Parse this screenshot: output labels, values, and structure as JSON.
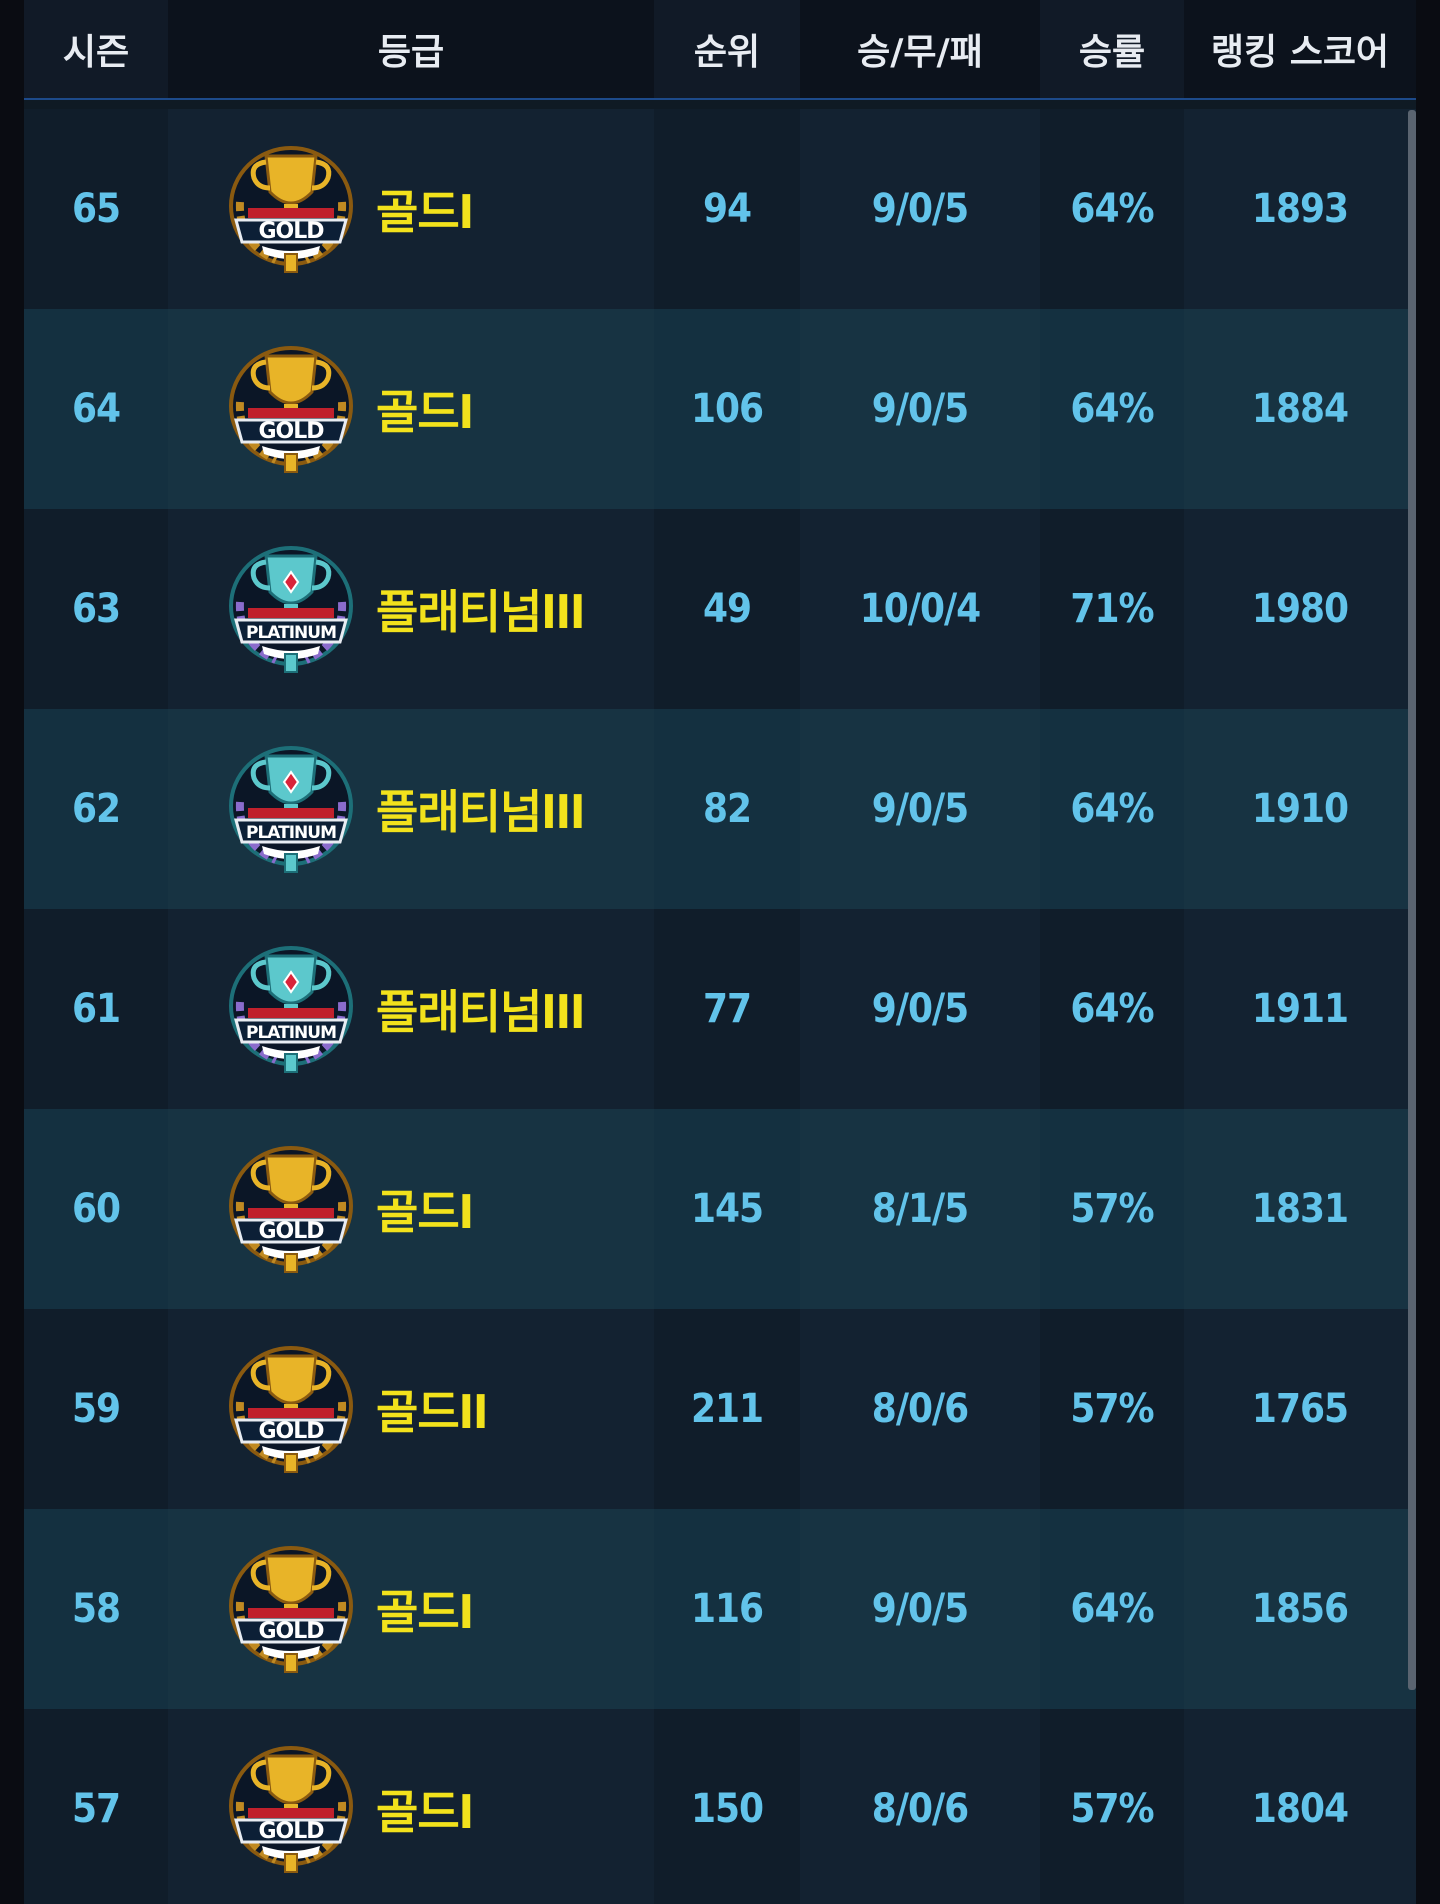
{
  "table": {
    "headers": {
      "season": "시즌",
      "grade": "등급",
      "rank": "순위",
      "wdl": "승/무/패",
      "win_rate": "승률",
      "ranking_score": "랭킹 스코어"
    },
    "rows": [
      {
        "season": "65",
        "badge": "gold-trophy-badge-icon",
        "badge_text": "GOLD",
        "tier": "골드I",
        "rank": "94",
        "wdl": "9/0/5",
        "win_rate": "64%",
        "score": "1893"
      },
      {
        "season": "64",
        "badge": "gold-trophy-badge-icon",
        "badge_text": "GOLD",
        "tier": "골드I",
        "rank": "106",
        "wdl": "9/0/5",
        "win_rate": "64%",
        "score": "1884"
      },
      {
        "season": "63",
        "badge": "platinum-trophy-badge-icon",
        "badge_text": "PLATINUM",
        "tier": "플래티넘III",
        "rank": "49",
        "wdl": "10/0/4",
        "win_rate": "71%",
        "score": "1980"
      },
      {
        "season": "62",
        "badge": "platinum-trophy-badge-icon",
        "badge_text": "PLATINUM",
        "tier": "플래티넘III",
        "rank": "82",
        "wdl": "9/0/5",
        "win_rate": "64%",
        "score": "1910"
      },
      {
        "season": "61",
        "badge": "platinum-trophy-badge-icon",
        "badge_text": "PLATINUM",
        "tier": "플래티넘III",
        "rank": "77",
        "wdl": "9/0/5",
        "win_rate": "64%",
        "score": "1911"
      },
      {
        "season": "60",
        "badge": "gold-trophy-badge-icon",
        "badge_text": "GOLD",
        "tier": "골드I",
        "rank": "145",
        "wdl": "8/1/5",
        "win_rate": "57%",
        "score": "1831"
      },
      {
        "season": "59",
        "badge": "gold-trophy-badge-icon",
        "badge_text": "GOLD",
        "tier": "골드II",
        "rank": "211",
        "wdl": "8/0/6",
        "win_rate": "57%",
        "score": "1765"
      },
      {
        "season": "58",
        "badge": "gold-trophy-badge-icon",
        "badge_text": "GOLD",
        "tier": "골드I",
        "rank": "116",
        "wdl": "9/0/5",
        "win_rate": "64%",
        "score": "1856"
      },
      {
        "season": "57",
        "badge": "gold-trophy-badge-icon",
        "badge_text": "GOLD",
        "tier": "골드I",
        "rank": "150",
        "wdl": "8/0/6",
        "win_rate": "57%",
        "score": "1804"
      }
    ]
  },
  "colors": {
    "tier_text": "#f2e21c",
    "stat_text": "#62c3ea",
    "header_text": "#e8ecf2",
    "gold": "#e8b428",
    "platinum": "#5cc8cc"
  }
}
